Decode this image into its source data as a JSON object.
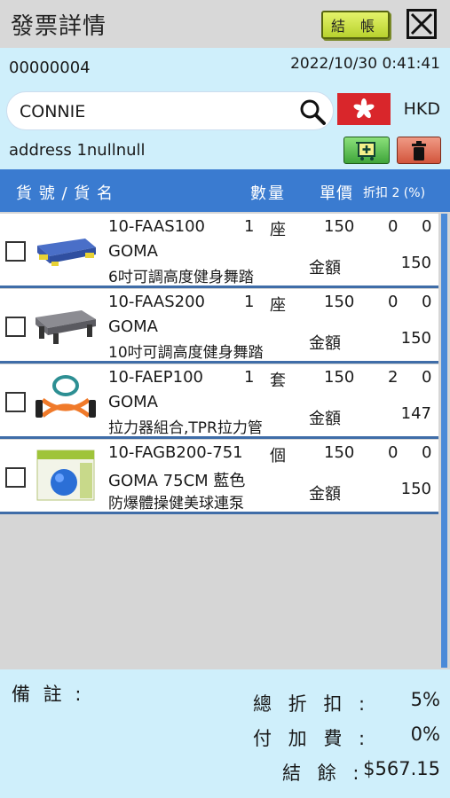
{
  "header": {
    "title": "發票詳情",
    "checkout_label": "結 帳"
  },
  "invoice": {
    "number": "00000004",
    "datetime": "2022/10/30  0:41:41",
    "customer_search": "CONNIE",
    "currency": "HKD",
    "address": "address 1nullnull"
  },
  "columns": {
    "name": "貨 號 / 貨 名",
    "qty": "數量",
    "price": "單價",
    "discount": "折扣 2 (%)"
  },
  "items": [
    {
      "code": "10-FAAS100",
      "brand": "GOMA",
      "desc": "6吋可調高度健身舞踏",
      "qty": "1",
      "unit": "座",
      "price": "150",
      "d1": "0",
      "d2": "0",
      "amount_label": "金額",
      "amount": "150"
    },
    {
      "code": "10-FAAS200",
      "brand": "GOMA",
      "desc": "10吋可調高度健身舞踏",
      "qty": "1",
      "unit": "座",
      "price": "150",
      "d1": "0",
      "d2": "0",
      "amount_label": "金額",
      "amount": "150"
    },
    {
      "code": "10-FAEP100",
      "brand": "GOMA",
      "desc": "拉力器組合,TPR拉力管",
      "qty": "1",
      "unit": "套",
      "price": "150",
      "d1": "2",
      "d2": "0",
      "amount_label": "金額",
      "amount": "147"
    },
    {
      "code": "10-FAGB200-751",
      "brand": "GOMA  75CM 藍色",
      "desc": "防爆體操健美球連泵",
      "qty": "",
      "unit": "個",
      "price": "150",
      "d1": "0",
      "d2": "0",
      "amount_label": "金額",
      "amount": "150"
    }
  ],
  "footer": {
    "remark_label": "備 註 :",
    "total_discount_label": "總 折 扣 :",
    "total_discount": "5%",
    "surcharge_label": "付 加 費 :",
    "surcharge": "0%",
    "balance_label": "結 餘 :",
    "balance": "$567.15"
  },
  "colors": {
    "header_blue": "#3a7bd0",
    "info_bg": "#cfeffb",
    "flag_red": "#d9262b"
  },
  "icons": [
    "close-icon",
    "search-icon",
    "hong-kong-flag-icon",
    "add-item-icon",
    "trash-icon"
  ]
}
